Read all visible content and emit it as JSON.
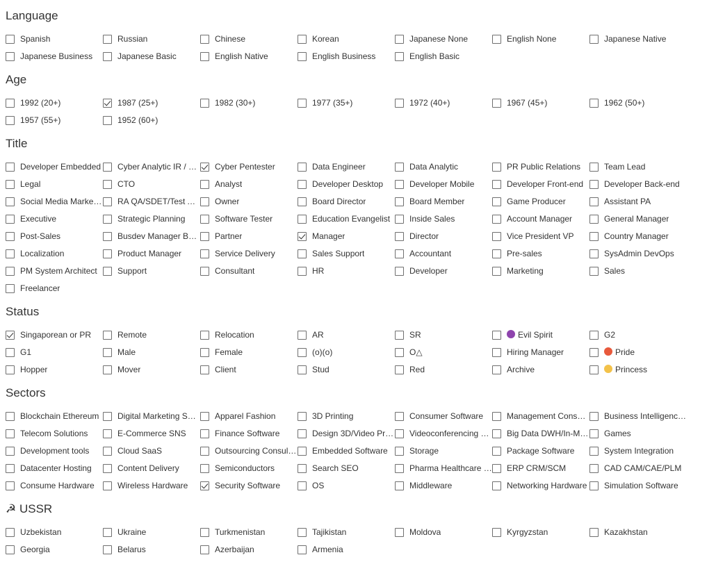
{
  "sections": [
    {
      "title": "Language",
      "items": [
        {
          "label": "Spanish",
          "checked": false
        },
        {
          "label": "Russian",
          "checked": false
        },
        {
          "label": "Chinese",
          "checked": false
        },
        {
          "label": "Korean",
          "checked": false
        },
        {
          "label": "Japanese None",
          "checked": false
        },
        {
          "label": "English None",
          "checked": false
        },
        {
          "label": "Japanese Native",
          "checked": false
        },
        {
          "label": "Japanese Business",
          "checked": false
        },
        {
          "label": "Japanese Basic",
          "checked": false
        },
        {
          "label": "English Native",
          "checked": false
        },
        {
          "label": "English Business",
          "checked": false
        },
        {
          "label": "English Basic",
          "checked": false
        }
      ]
    },
    {
      "title": "Age",
      "items": [
        {
          "label": "1992 (20+)",
          "checked": false
        },
        {
          "label": "1987 (25+)",
          "checked": true
        },
        {
          "label": "1982 (30+)",
          "checked": false
        },
        {
          "label": "1977 (35+)",
          "checked": false
        },
        {
          "label": "1972 (40+)",
          "checked": false
        },
        {
          "label": "1967 (45+)",
          "checked": false
        },
        {
          "label": "1962 (50+)",
          "checked": false
        },
        {
          "label": "1957 (55+)",
          "checked": false
        },
        {
          "label": "1952 (60+)",
          "checked": false
        }
      ]
    },
    {
      "title": "Title",
      "items": [
        {
          "label": "Developer Embedded",
          "checked": false
        },
        {
          "label": "Cyber Analytic IR / …",
          "checked": false
        },
        {
          "label": "Cyber Pentester",
          "checked": true
        },
        {
          "label": "Data Engineer",
          "checked": false
        },
        {
          "label": "Data Analytic",
          "checked": false
        },
        {
          "label": "PR Public Relations",
          "checked": false
        },
        {
          "label": "Team Lead",
          "checked": false
        },
        {
          "label": "Legal",
          "checked": false
        },
        {
          "label": "CTO",
          "checked": false
        },
        {
          "label": "Analyst",
          "checked": false
        },
        {
          "label": "Developer Desktop",
          "checked": false
        },
        {
          "label": "Developer Mobile",
          "checked": false
        },
        {
          "label": "Developer Front-end",
          "checked": false
        },
        {
          "label": "Developer Back-end",
          "checked": false
        },
        {
          "label": "Social Media Market…",
          "checked": false
        },
        {
          "label": "RA QA/SDET/Test A…",
          "checked": false
        },
        {
          "label": "Owner",
          "checked": false
        },
        {
          "label": "Board Director",
          "checked": false
        },
        {
          "label": "Board Member",
          "checked": false
        },
        {
          "label": "Game Producer",
          "checked": false
        },
        {
          "label": "Assistant PA",
          "checked": false
        },
        {
          "label": "Executive",
          "checked": false
        },
        {
          "label": "Strategic Planning",
          "checked": false
        },
        {
          "label": "Software Tester",
          "checked": false
        },
        {
          "label": "Education Evangelist",
          "checked": false
        },
        {
          "label": "Inside Sales",
          "checked": false
        },
        {
          "label": "Account Manager",
          "checked": false
        },
        {
          "label": "General Manager",
          "checked": false
        },
        {
          "label": "Post-Sales",
          "checked": false
        },
        {
          "label": "Busdev Manager BDM",
          "checked": false
        },
        {
          "label": "Partner",
          "checked": false
        },
        {
          "label": "Manager",
          "checked": true
        },
        {
          "label": "Director",
          "checked": false
        },
        {
          "label": "Vice President VP",
          "checked": false
        },
        {
          "label": "Country Manager",
          "checked": false
        },
        {
          "label": "Localization",
          "checked": false
        },
        {
          "label": "Product Manager",
          "checked": false
        },
        {
          "label": "Service Delivery",
          "checked": false
        },
        {
          "label": "Sales Support",
          "checked": false
        },
        {
          "label": "Accountant",
          "checked": false
        },
        {
          "label": "Pre-sales",
          "checked": false
        },
        {
          "label": "SysAdmin DevOps",
          "checked": false
        },
        {
          "label": "PM System Architect",
          "checked": false
        },
        {
          "label": "Support",
          "checked": false
        },
        {
          "label": "Consultant",
          "checked": false
        },
        {
          "label": "HR",
          "checked": false
        },
        {
          "label": "Developer",
          "checked": false
        },
        {
          "label": "Marketing",
          "checked": false
        },
        {
          "label": "Sales",
          "checked": false
        },
        {
          "label": "Freelancer",
          "checked": false
        }
      ]
    },
    {
      "title": "Status",
      "items": [
        {
          "label": "Singaporean or PR",
          "checked": true
        },
        {
          "label": "Remote",
          "checked": false
        },
        {
          "label": "Relocation",
          "checked": false
        },
        {
          "label": "AR",
          "checked": false
        },
        {
          "label": "SR",
          "checked": false
        },
        {
          "label": "Evil Spirit",
          "checked": false,
          "icon": "evil-spirit-icon",
          "icon_color": "#8e44ad"
        },
        {
          "label": "G2",
          "checked": false
        },
        {
          "label": "G1",
          "checked": false
        },
        {
          "label": "Male",
          "checked": false
        },
        {
          "label": "Female",
          "checked": false
        },
        {
          "label": "(o)(o)",
          "checked": false
        },
        {
          "label": "O△",
          "checked": false
        },
        {
          "label": "Hiring Manager",
          "checked": false
        },
        {
          "label": "Pride",
          "checked": false,
          "icon": "rainbow-icon",
          "icon_color": "#e8593c"
        },
        {
          "label": "Hopper",
          "checked": false
        },
        {
          "label": "Mover",
          "checked": false
        },
        {
          "label": "Client",
          "checked": false
        },
        {
          "label": "Stud",
          "checked": false
        },
        {
          "label": "Red",
          "checked": false
        },
        {
          "label": "Archive",
          "checked": false
        },
        {
          "label": "Princess",
          "checked": false,
          "icon": "princess-icon",
          "icon_color": "#f3c24a"
        }
      ]
    },
    {
      "title": "Sectors",
      "items": [
        {
          "label": "Blockchain Ethereum",
          "checked": false
        },
        {
          "label": "Digital Marketing Sol…",
          "checked": false
        },
        {
          "label": "Apparel Fashion",
          "checked": false
        },
        {
          "label": "3D Printing",
          "checked": false
        },
        {
          "label": "Consumer Software",
          "checked": false
        },
        {
          "label": "Management Consul…",
          "checked": false
        },
        {
          "label": "Business Intelligenc…",
          "checked": false
        },
        {
          "label": "Telecom Solutions",
          "checked": false
        },
        {
          "label": "E-Commerce SNS",
          "checked": false
        },
        {
          "label": "Finance Software",
          "checked": false
        },
        {
          "label": "Design 3D/Video Pr…",
          "checked": false
        },
        {
          "label": "Videoconferencing V…",
          "checked": false
        },
        {
          "label": "Big Data DWH/In-Me…",
          "checked": false
        },
        {
          "label": "Games",
          "checked": false
        },
        {
          "label": "Development tools",
          "checked": false
        },
        {
          "label": "Cloud SaaS",
          "checked": false
        },
        {
          "label": "Outsourcing Consult…",
          "checked": false
        },
        {
          "label": "Embedded Software",
          "checked": false
        },
        {
          "label": "Storage",
          "checked": false
        },
        {
          "label": "Package Software",
          "checked": false
        },
        {
          "label": "System Integration",
          "checked": false
        },
        {
          "label": "Datacenter Hosting",
          "checked": false
        },
        {
          "label": "Content Delivery",
          "checked": false
        },
        {
          "label": "Semiconductors",
          "checked": false
        },
        {
          "label": "Search SEO",
          "checked": false
        },
        {
          "label": "Pharma Healthcare …",
          "checked": false
        },
        {
          "label": "ERP CRM/SCM",
          "checked": false
        },
        {
          "label": "CAD CAM/CAE/PLM",
          "checked": false
        },
        {
          "label": "Consume Hardware",
          "checked": false
        },
        {
          "label": "Wireless Hardware",
          "checked": false
        },
        {
          "label": "Security Software",
          "checked": true
        },
        {
          "label": "OS",
          "checked": false
        },
        {
          "label": "Middleware",
          "checked": false
        },
        {
          "label": "Networking Hardware",
          "checked": false
        },
        {
          "label": "Simulation Software",
          "checked": false
        }
      ]
    },
    {
      "title": "☭ USSR",
      "items": [
        {
          "label": "Uzbekistan",
          "checked": false
        },
        {
          "label": "Ukraine",
          "checked": false
        },
        {
          "label": "Turkmenistan",
          "checked": false
        },
        {
          "label": "Tajikistan",
          "checked": false
        },
        {
          "label": "Moldova",
          "checked": false
        },
        {
          "label": "Kyrgyzstan",
          "checked": false
        },
        {
          "label": "Kazakhstan",
          "checked": false
        },
        {
          "label": "Georgia",
          "checked": false
        },
        {
          "label": "Belarus",
          "checked": false
        },
        {
          "label": "Azerbaijan",
          "checked": false
        },
        {
          "label": "Armenia",
          "checked": false
        }
      ]
    }
  ]
}
